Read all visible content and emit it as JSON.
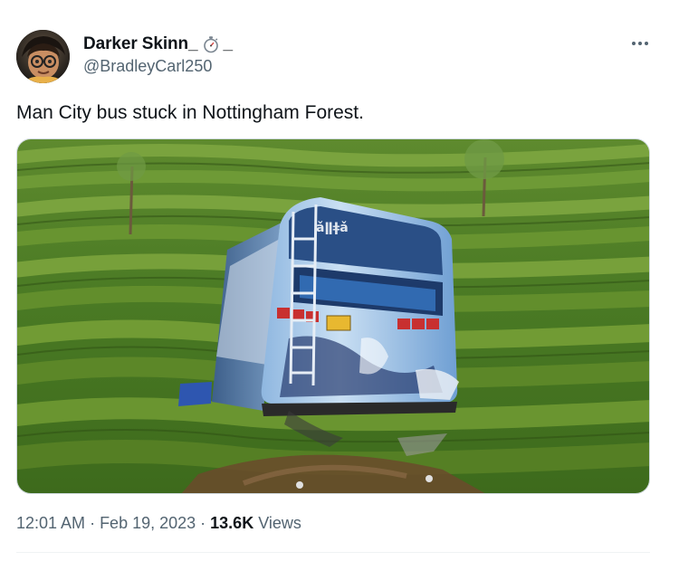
{
  "author": {
    "display_name": "Darker Skinn_",
    "name_suffix": "_",
    "handle": "@BradleyCarl250",
    "name_emoji_icon": "stopwatch-icon"
  },
  "tweet": {
    "text": "Man City bus stuck in Nottingham Forest.",
    "media_description_icon": "photo-bus-in-tea-plantation"
  },
  "meta": {
    "time": "12:01 AM",
    "separator": "·",
    "date": "Feb 19, 2023",
    "views_count": "13.6K",
    "views_label": "Views"
  },
  "colors": {
    "primary_text": "#0f1419",
    "secondary_text": "#536471",
    "border": "#cfd9de",
    "divider": "#eff3f4"
  }
}
